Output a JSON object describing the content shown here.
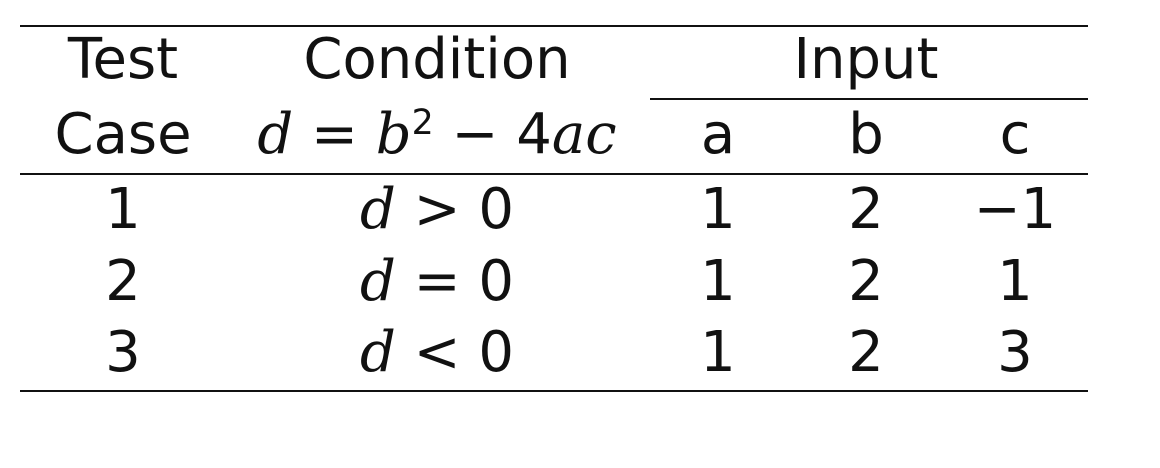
{
  "table": {
    "headers": {
      "test_case_line1": "Test",
      "test_case_line2": "Case",
      "condition_line1": "Condition",
      "condition_formula": {
        "lhs": "d",
        "eq": "=",
        "b": "b",
        "exp": "2",
        "minus": "−",
        "coef": "4",
        "ac": "ac"
      },
      "input_group": "Input",
      "input_cols": [
        "a",
        "b",
        "c"
      ]
    },
    "rows": [
      {
        "case": "1",
        "cond_var": "d",
        "cond_op": ">",
        "cond_val": "0",
        "a": "1",
        "b": "2",
        "c": "−1"
      },
      {
        "case": "2",
        "cond_var": "d",
        "cond_op": "=",
        "cond_val": "0",
        "a": "1",
        "b": "2",
        "c": "1"
      },
      {
        "case": "3",
        "cond_var": "d",
        "cond_op": "<",
        "cond_val": "0",
        "a": "1",
        "b": "2",
        "c": "3"
      }
    ]
  }
}
